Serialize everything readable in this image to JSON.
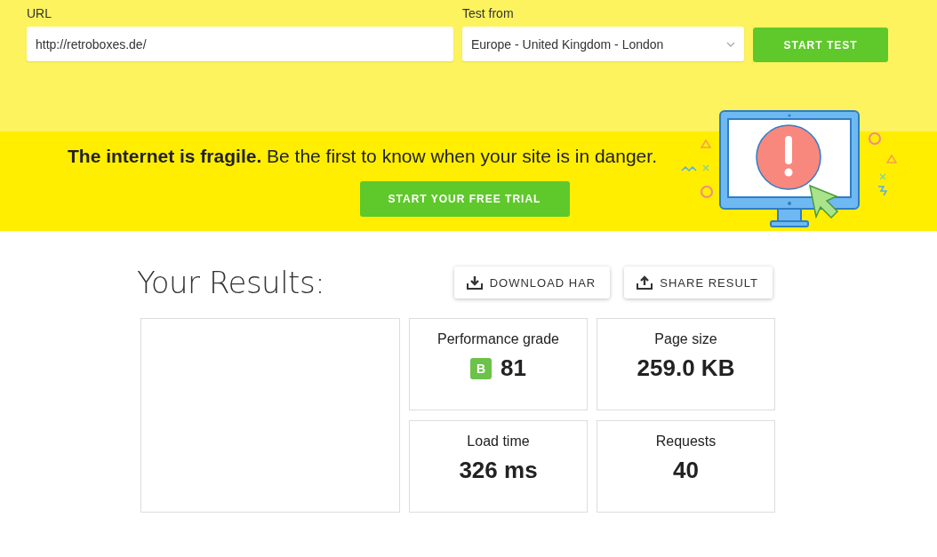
{
  "test_form": {
    "url_label": "URL",
    "url_value": "http://retroboxes.de/",
    "location_label": "Test from",
    "location_value": "Europe - United Kingdom - London",
    "start_button": "START TEST"
  },
  "banner": {
    "headline": "The internet is fragile.",
    "text": "Be the first to know when your site is in danger.",
    "trial_button": "START YOUR FREE TRIAL"
  },
  "results": {
    "title": "Your Results:",
    "actions": [
      {
        "label": "DOWNLOAD HAR",
        "kind": "download"
      },
      {
        "label": "SHARE RESULT",
        "kind": "share"
      }
    ],
    "metrics": [
      {
        "label": "Performance grade",
        "value": "81",
        "grade": "B"
      },
      {
        "label": "Page size",
        "value": "259.0 KB"
      },
      {
        "label": "Load time",
        "value": "326 ms"
      },
      {
        "label": "Requests",
        "value": "40"
      }
    ]
  }
}
